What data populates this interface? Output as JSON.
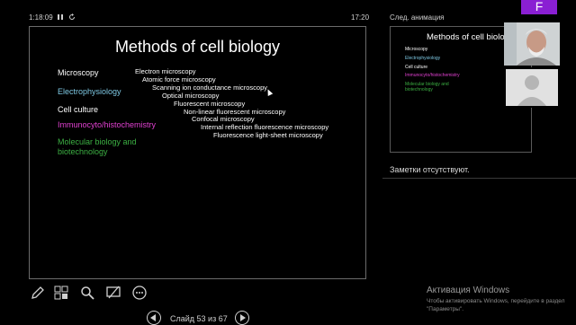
{
  "top": {
    "timer": "1:18:09",
    "clock": "17:20",
    "next_label": "След. анимация",
    "badge": "F"
  },
  "slide": {
    "title": "Methods of cell biology",
    "categories": [
      {
        "label": "Microscopy",
        "color": "#ffffff"
      },
      {
        "label": "Electrophysiology",
        "color": "#7ec8e3"
      },
      {
        "label": "Cell culture",
        "color": "#ffffff"
      },
      {
        "label": "Immunocyto/histochemistry",
        "color": "#e040d0"
      },
      {
        "label": "Molecular biology and",
        "color": "#3cb043"
      },
      {
        "label": "biotechnology",
        "color": "#3cb043"
      }
    ],
    "techniques": [
      "Electron microscopy",
      "Atomic force microscopy",
      "Scanning ion conductance microscopy",
      "Optical microscopy",
      "Fluorescent microscopy",
      "Non-linear fluorescent microscopy",
      "Confocal microscopy",
      "Internal reflection fluorescence microscopy",
      "Fluorescence light-sheet microscopy"
    ]
  },
  "thumb": {
    "title": "Methods of cell biolog",
    "categories": [
      {
        "label": "Microscopy",
        "color": "#ffffff"
      },
      {
        "label": "Electrophysiology",
        "color": "#7ec8e3"
      },
      {
        "label": "Cell culture",
        "color": "#ffffff"
      },
      {
        "label": "Immunocyto/histochemistry",
        "color": "#e040d0"
      },
      {
        "label": "Molecular biology and",
        "color": "#3cb043"
      },
      {
        "label": "biotechnology",
        "color": "#3cb043"
      }
    ]
  },
  "notes": "Заметки отсутствуют.",
  "nav": {
    "slide_counter": "Слайд 53 из 67"
  },
  "watermark": {
    "title": "Активация Windows",
    "text": "Чтобы активировать Windows, перейдите в раздел \"Параметры\"."
  }
}
